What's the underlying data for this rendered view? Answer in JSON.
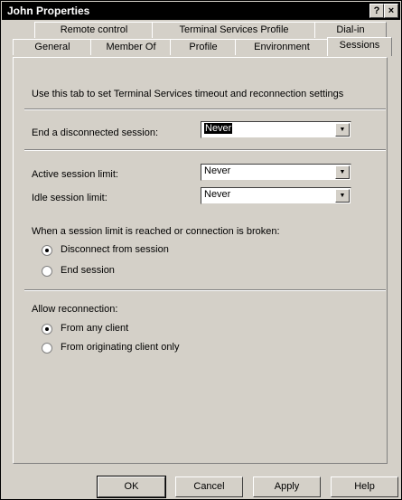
{
  "window": {
    "title": "John Properties",
    "help_label": "?",
    "close_label": "×"
  },
  "tabs": {
    "row1": [
      "Remote control",
      "Terminal Services Profile",
      "Dial-in"
    ],
    "row2": [
      "General",
      "Member Of",
      "Profile",
      "Environment",
      "Sessions"
    ]
  },
  "sessions": {
    "description": "Use this tab to set Terminal Services timeout and reconnection settings",
    "end_disconnected_label": "End a disconnected session:",
    "end_disconnected_value": "Never",
    "active_limit_label": "Active session limit:",
    "active_limit_value": "Never",
    "idle_limit_label": "Idle session limit:",
    "idle_limit_value": "Never",
    "limit_reached_label": "When a session limit is reached or connection is broken:",
    "disconnect_option": "Disconnect from session",
    "end_session_option": "End session",
    "allow_reconnection_label": "Allow reconnection:",
    "any_client_option": "From any client",
    "originating_client_option": "From originating client only"
  },
  "buttons": {
    "ok": "OK",
    "cancel": "Cancel",
    "apply": "Apply",
    "help": "Help"
  }
}
